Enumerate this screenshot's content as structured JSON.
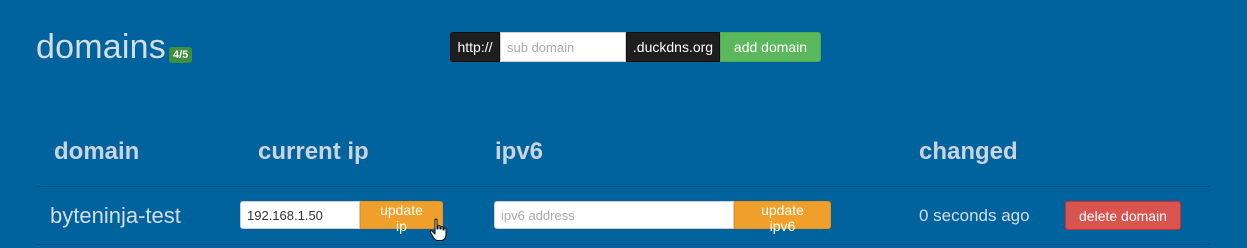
{
  "header": {
    "title": "domains",
    "badge": "4/5"
  },
  "add_domain": {
    "prefix": "http://",
    "placeholder": "sub domain",
    "suffix": ".duckdns.org",
    "button_label": "add domain"
  },
  "table": {
    "columns": [
      "domain",
      "current ip",
      "ipv6",
      "changed"
    ],
    "rows": [
      {
        "domain": "byteninja-test",
        "current_ip": "192.168.1.50",
        "update_ip_label": "update ip",
        "ipv6_placeholder": "ipv6 address",
        "update_ipv6_label": "update ipv6",
        "changed": "0 seconds ago",
        "delete_label": "delete domain"
      }
    ]
  },
  "colors": {
    "background": "#00639e",
    "green": "#5cb85c",
    "orange": "#f0a02a",
    "red": "#d9534f",
    "badge": "#3f8f3f"
  },
  "icons": {
    "cursor": "hand-pointer-cursor-icon"
  }
}
